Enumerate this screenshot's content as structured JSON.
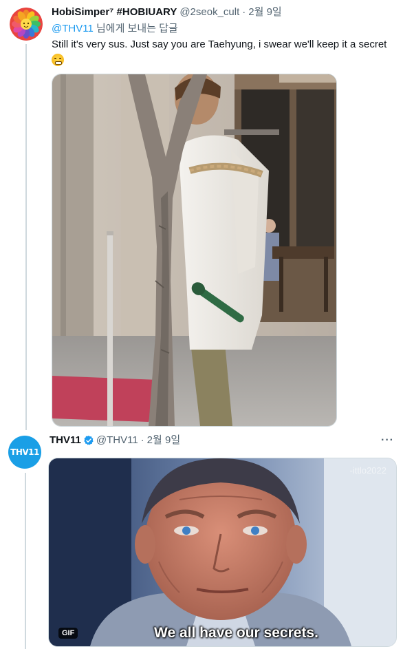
{
  "tweet1": {
    "display_name": "HobiSimper⁷ #HOBIUARY",
    "handle": "@2seok_cult",
    "separator": "·",
    "date": "2월 9일",
    "reply_to_mention": "@THV11",
    "reply_to_suffix": " 님에게 보내는 답글",
    "text": "Still it's very sus. Just say you are Taehyung, i swear  we'll keep it a secret",
    "emoji": "face-with-steam-icon",
    "avatar_icon": "rainbow-flower-icon"
  },
  "tweet2": {
    "display_name": "THV11",
    "verified_icon": "verified-badge-icon",
    "handle": "@THV11",
    "separator": "·",
    "date": "2월 9일",
    "avatar_text": "THV11",
    "more_label": "···",
    "gif_badge": "GIF",
    "caption": "We all have our secrets.",
    "watermark": "-ittlo2022"
  },
  "colors": {
    "link": "#1d9bf0",
    "secondary_text": "#536471",
    "thread_line": "#cfd9de",
    "thv_avatar": "#1a9fe6"
  }
}
